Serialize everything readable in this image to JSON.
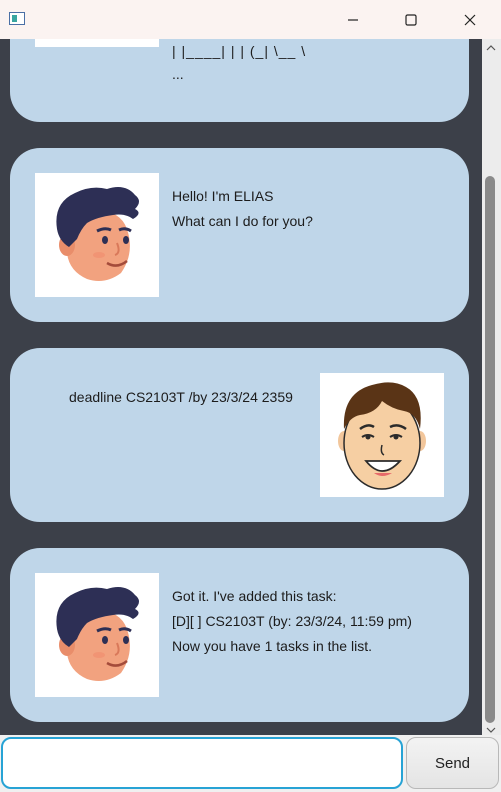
{
  "window": {
    "title": "",
    "controls": {
      "minimize": "minimize-icon",
      "maximize": "maximize-icon",
      "close": "close-icon"
    }
  },
  "messages": [
    {
      "sender": "bot",
      "lines": [
        "| |____| | | (_| \\__ \\",
        "..."
      ]
    },
    {
      "sender": "bot",
      "lines": [
        "Hello! I'm ELIAS",
        "What can I do for you?"
      ]
    },
    {
      "sender": "user",
      "lines": [
        "deadline CS2103T /by 23/3/24 2359"
      ]
    },
    {
      "sender": "bot",
      "lines": [
        "Got it. I've added this task:",
        "[D][ ] CS2103T (by: 23/3/24, 11:59 pm)",
        "Now you have 1 tasks in the list."
      ]
    }
  ],
  "input": {
    "value": "",
    "placeholder": ""
  },
  "send_button": {
    "label": "Send"
  },
  "colors": {
    "chat_background": "#3c4049",
    "bubble": "#bfd6e9",
    "input_border": "#27a3d5"
  }
}
